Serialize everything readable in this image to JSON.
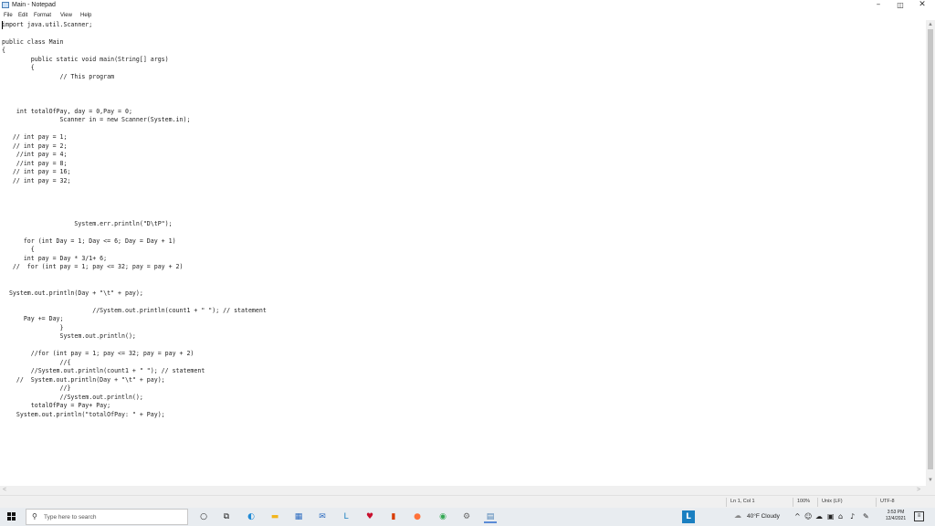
{
  "window": {
    "title": "Main - Notepad",
    "minimize_glyph": "–",
    "maximize_glyph": "◫",
    "close_glyph": "✕"
  },
  "menu": [
    "File",
    "Edit",
    "Format",
    "View",
    "Help"
  ],
  "code_lines": [
    "import java.util.Scanner;",
    "",
    "public class Main",
    "{",
    "        public static void main(String[] args)",
    "        {",
    "                // This program",
    "",
    "",
    "",
    "    int totalOfPay, day = 0,Pay = 0;",
    "                Scanner in = new Scanner(System.in);",
    "",
    "   // int pay = 1;",
    "   // int pay = 2;",
    "    //int pay = 4;",
    "    //int pay = 8;",
    "   // int pay = 16;",
    "   // int pay = 32;",
    "",
    "",
    "",
    "",
    "                    System.err.println(\"D\\tP\");",
    "",
    "      for (int Day = 1; Day <= 6; Day = Day + 1)",
    "        {",
    "      int pay = Day * 3/1+ 6;",
    "   //  for (int pay = 1; pay <= 32; pay = pay + 2)",
    "",
    "",
    "  System.out.println(Day + \"\\t\" + pay);",
    "",
    "                         //System.out.println(count1 + \" \"); // statement",
    "      Pay += Day;",
    "                }",
    "                System.out.println();",
    "",
    "        //for (int pay = 1; pay <= 32; pay = pay + 2)",
    "                //{",
    "        //System.out.println(count1 + \" \"); // statement",
    "    //  System.out.println(Day + \"\\t\" + pay);",
    "                //}",
    "                //System.out.println();",
    "        totalOfPay = Pay+ Pay;",
    "    System.out.println(\"totalOfPay: \" + Pay);"
  ],
  "status": {
    "position": "Ln 1, Col 1",
    "zoom": "100%",
    "line_ending": "Unix (LF)",
    "encoding": "UTF-8"
  },
  "scrollbars": {
    "up": "▲",
    "down": "▼",
    "left": "<",
    "right": ">"
  },
  "taskbar": {
    "search_placeholder": "Type here to search",
    "search_glyph": "⚲",
    "pinned": [
      {
        "name": "cortana-icon",
        "glyph": "○",
        "color": "#222222"
      },
      {
        "name": "task-view-icon",
        "glyph": "⧉",
        "color": "#222222"
      },
      {
        "name": "edge-icon",
        "glyph": "◐",
        "color": "#1f8ad6"
      },
      {
        "name": "file-explorer-icon",
        "glyph": "▬",
        "color": "#f2b51d"
      },
      {
        "name": "store-icon",
        "glyph": "▦",
        "color": "#2d6cc0"
      },
      {
        "name": "mail-icon",
        "glyph": "✉",
        "color": "#2d6cc0"
      },
      {
        "name": "app-l-icon",
        "glyph": "L",
        "color": "#1a7fc1"
      },
      {
        "name": "mcafee-icon",
        "glyph": "♥",
        "color": "#c8102e"
      },
      {
        "name": "office-icon",
        "glyph": "▮",
        "color": "#d83b01"
      },
      {
        "name": "firefox-icon",
        "glyph": "●",
        "color": "#ff7139"
      },
      {
        "name": "chrome-icon",
        "glyph": "◉",
        "color": "#34a853"
      },
      {
        "name": "settings-icon",
        "glyph": "⚙",
        "color": "#666666"
      },
      {
        "name": "notepad-icon",
        "glyph": "▤",
        "color": "#4a7fb5"
      }
    ],
    "tray_app": {
      "glyph": "L",
      "color": "#1a7fc1"
    },
    "weather_glyph": "☁",
    "weather": "40°F  Cloudy",
    "tray_icons": [
      "^",
      "☺",
      "☁",
      "▣",
      "⌂",
      "♪",
      "✎"
    ],
    "time": "3:53 PM",
    "date": "12/4/2021",
    "notification_glyph": "≡"
  },
  "colors": {
    "caret": "#000000",
    "start_button": "#111111"
  }
}
